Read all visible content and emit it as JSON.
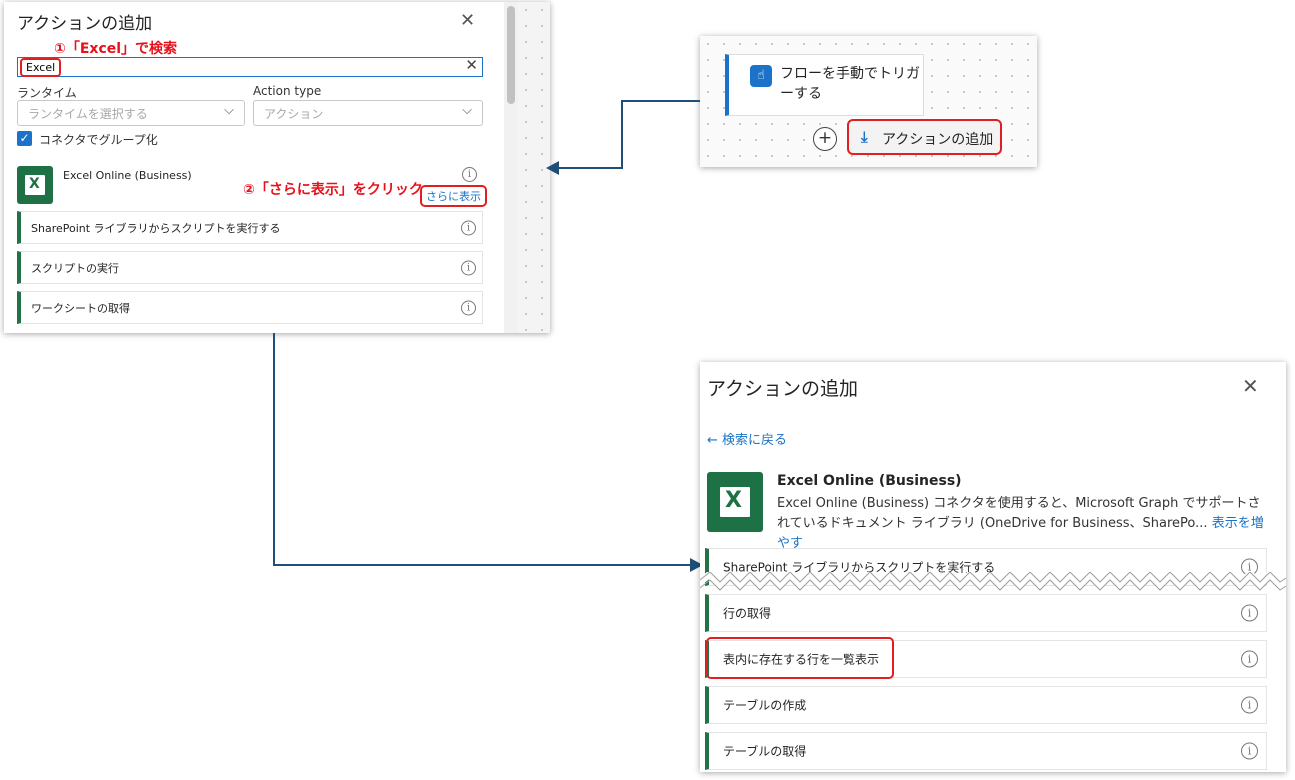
{
  "panel1": {
    "title": "アクションの追加",
    "annotation_search": "①「Excel」で検索",
    "search_value": "Excel",
    "runtime_label": "ランタイム",
    "runtime_placeholder": "ランタイムを選択する",
    "action_type_label": "Action type",
    "action_type_placeholder": "アクション",
    "group_by_connector_label": "コネクタでグループ化",
    "group_by_connector_checked": true,
    "connector_name": "Excel Online (Business)",
    "annotation_more": "②「さらに表示」をクリック",
    "show_more_link": "さらに表示",
    "actions": [
      "SharePoint ライブラリからスクリプトを実行する",
      "スクリプトの実行",
      "ワークシートの取得"
    ]
  },
  "panel2": {
    "trigger_label": "フローを手動でトリガーする",
    "add_action_label": "アクションの追加"
  },
  "panel3": {
    "title": "アクションの追加",
    "back_link": "← 検索に戻る",
    "connector_name": "Excel Online (Business)",
    "description": "Excel Online (Business) コネクタを使用すると、Microsoft Graph でサポートされているドキュメント ライブラリ (OneDrive for Business、SharePo...",
    "show_more_link": "表示を増やす",
    "actions": [
      "SharePoint ライブラリからスクリプトを実行する",
      "行の取得",
      "表内に存在する行を一覧表示",
      "テーブルの作成",
      "テーブルの取得"
    ]
  },
  "colors": {
    "excel_green": "#217346",
    "link_blue": "#1a73c8",
    "annotation_red": "#e02020",
    "arrow_navy": "#1f4e79"
  }
}
